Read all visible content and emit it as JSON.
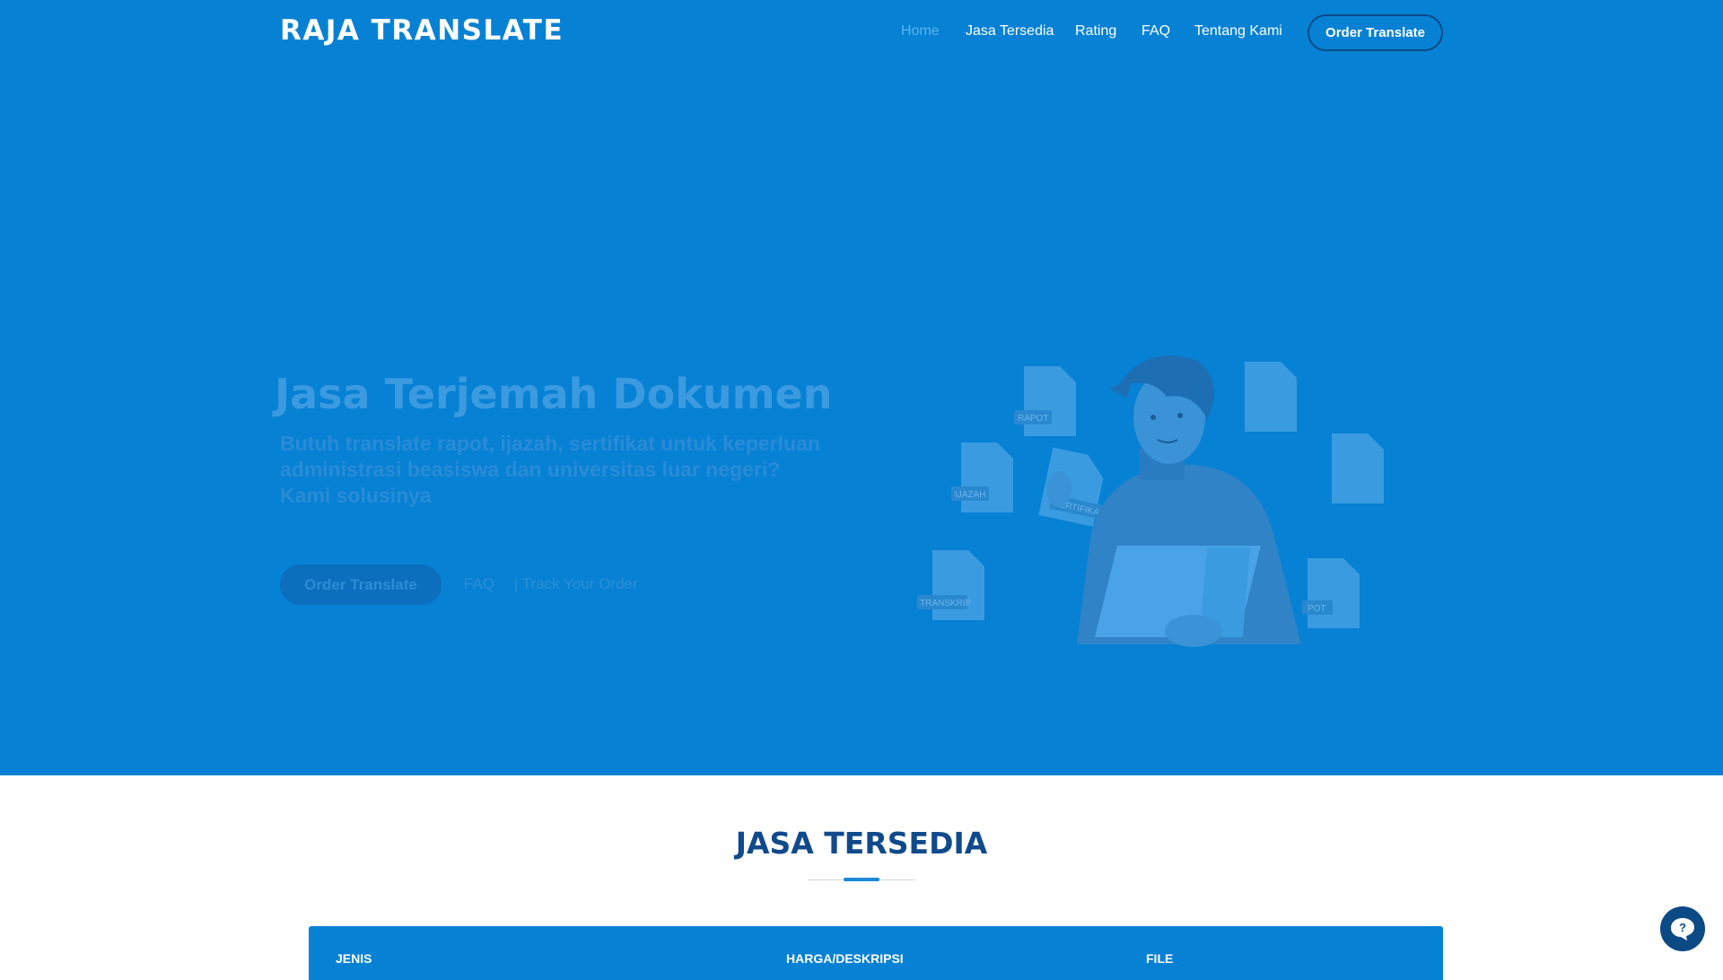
{
  "header": {
    "logo": "RAJA TRANSLATE",
    "nav": [
      "Home",
      "Jasa Tersedia",
      "Rating",
      "FAQ",
      "Tentang Kami"
    ],
    "order_button": "Order Translate"
  },
  "hero": {
    "title": "Jasa Terjemah Dokumen",
    "subtitle": "Butuh translate rapot, ijazah, sertifikat untuk keperluan administrasi beasiswa dan universitas luar negeri? Kami solusinya",
    "order_button": "Order Translate",
    "faq_link": "FAQ",
    "track_link": "| Track Your Order",
    "illustration_labels": [
      "RAPOT",
      "IJAZAH",
      "SERTIFIKAT",
      "TRANSKRIP",
      "POT"
    ]
  },
  "services": {
    "title": "JASA TERSEDIA",
    "columns": [
      "JENIS",
      "HARGA/DESKRIPSI",
      "FILE"
    ]
  },
  "colors": {
    "hero_bg": "#0781d4",
    "title_dark": "#114a8c",
    "accent": "#1a8ad8"
  },
  "icons": [
    "help-chat-icon"
  ]
}
